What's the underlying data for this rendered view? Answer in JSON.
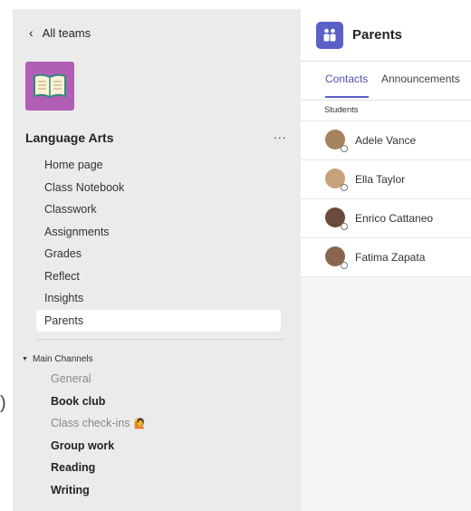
{
  "outside_edge_text": ")",
  "sidebar": {
    "back_label": "All teams",
    "team_name": "Language Arts",
    "more_label": "...",
    "nav_items": [
      {
        "label": "Home page"
      },
      {
        "label": "Class Notebook"
      },
      {
        "label": "Classwork"
      },
      {
        "label": "Assignments"
      },
      {
        "label": "Grades"
      },
      {
        "label": "Reflect"
      },
      {
        "label": "Insights"
      },
      {
        "label": "Parents",
        "active": true
      }
    ],
    "channels_header": "Main Channels",
    "channels": [
      {
        "label": "General",
        "style": "muted"
      },
      {
        "label": "Book club",
        "style": "bold"
      },
      {
        "label": "Class check-ins",
        "style": "muted",
        "emoji": "🙋"
      },
      {
        "label": "Group work",
        "style": "bold"
      },
      {
        "label": "Reading",
        "style": "bold"
      },
      {
        "label": "Writing",
        "style": "bold"
      }
    ]
  },
  "main": {
    "title": "Parents",
    "tabs": [
      {
        "label": "Contacts",
        "active": true
      },
      {
        "label": "Announcements"
      }
    ],
    "section_label": "Students",
    "students": [
      {
        "name": "Adele Vance",
        "avatar_color": "#a6825f"
      },
      {
        "name": "Ella Taylor",
        "avatar_color": "#c7a17a"
      },
      {
        "name": "Enrico Cattaneo",
        "avatar_color": "#6a4a3a"
      },
      {
        "name": "Fatima Zapata",
        "avatar_color": "#8a6650"
      }
    ]
  },
  "colors": {
    "accent": "#5b5fc7",
    "team_tile": "#b05fb5",
    "sidebar_bg": "#ebebeb"
  }
}
